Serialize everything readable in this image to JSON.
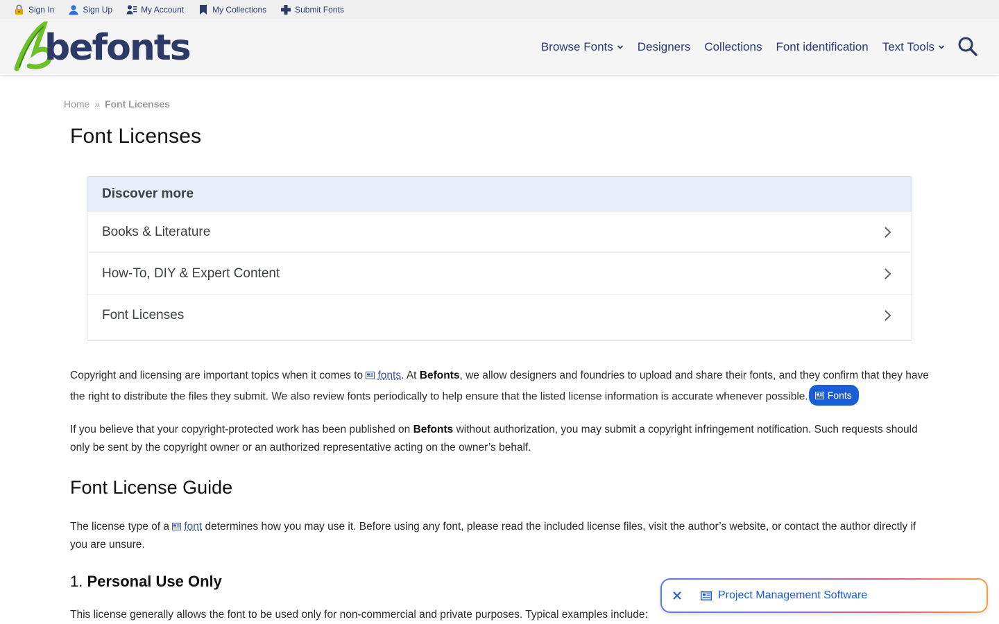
{
  "topbar": {
    "items": [
      {
        "label": "Sign In",
        "icon": "lock-icon"
      },
      {
        "label": "Sign Up",
        "icon": "user-icon"
      },
      {
        "label": "My Account",
        "icon": "account-list-icon"
      },
      {
        "label": "My Collections",
        "icon": "bookmark-icon"
      },
      {
        "label": "Submit Fonts",
        "icon": "plus-icon"
      }
    ]
  },
  "header": {
    "logo_text": "befonts",
    "nav": [
      {
        "label": "Browse Fonts",
        "has_dropdown": true
      },
      {
        "label": "Designers",
        "has_dropdown": false
      },
      {
        "label": "Collections",
        "has_dropdown": false
      },
      {
        "label": "Font identification",
        "has_dropdown": false
      },
      {
        "label": "Text Tools",
        "has_dropdown": true
      }
    ],
    "search_icon": "search-icon"
  },
  "breadcrumb": {
    "home": "Home",
    "separator": "»",
    "current": "Font Licenses"
  },
  "page_title": "Font Licenses",
  "discover": {
    "heading": "Discover more",
    "items": [
      {
        "label": "Books & Literature"
      },
      {
        "label": "How-To, DIY & Expert Content"
      },
      {
        "label": "Font Licenses"
      }
    ]
  },
  "content": {
    "p1": {
      "a": "Copyright and licensing are important topics when it comes to ",
      "link": "fonts",
      "b": ". At ",
      "brand": "Befonts",
      "c": ", we allow designers and foundries to upload and share their fonts, and they confirm that they have the right to distribute the files they submit. We also review fonts periodically to help ensure that the listed license information is accurate whenever possible.",
      "pill": "Fonts"
    },
    "p2": {
      "a": "If you believe that your copyright-protected work has been published on ",
      "brand": "Befonts",
      "b": " without authorization, you may submit a copyright infringement notification. Such requests should only be sent by the copyright owner or an authorized representative acting on the owner’s behalf."
    },
    "guide_heading": "Font License Guide",
    "p3": {
      "a": "The license type of a ",
      "link": "font",
      "b": " determines how you may use it. Before using any font, please read the included license files, visit the author’s website, or contact the author directly if you are unsure."
    },
    "section1": {
      "number": "1.",
      "title": "Personal Use Only"
    },
    "p4": "This license generally allows the font to be used only for non-commercial and private purposes. Typical examples include:"
  },
  "float_ad": {
    "label": "Project Management Software"
  },
  "colors": {
    "nav_text": "#2a3a6e",
    "discover_head_bg": "#e8effb",
    "pill_bg": "#1a5dd6",
    "logo_green": "#6cc02a",
    "logo_navy": "#2b3a66"
  }
}
